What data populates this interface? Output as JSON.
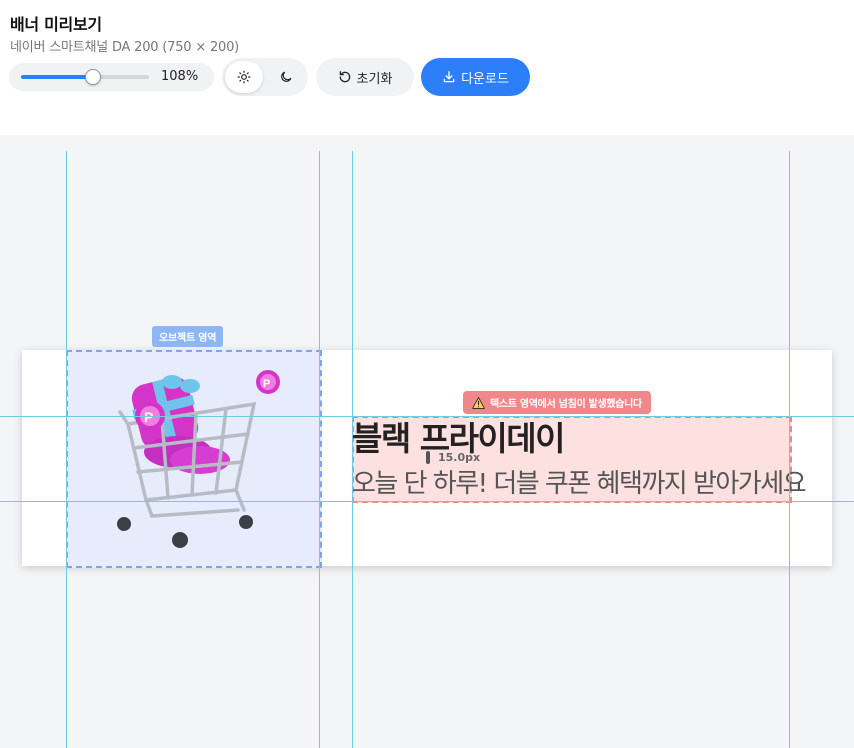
{
  "header": {
    "title": "배너 미리보기",
    "subtitle": "네이버 스마트채널 DA 200 (750 × 200)"
  },
  "toolbar": {
    "zoom": {
      "percent": 108,
      "label": "108%",
      "slider_fraction": 0.56
    },
    "theme": {
      "light_icon": "sun-icon",
      "dark_icon": "moon-icon",
      "active": "light"
    },
    "reset_label": "초기화",
    "reset_icon": "reset-icon",
    "download_label": "다운로드",
    "download_icon": "download-icon"
  },
  "banner": {
    "object_area_label": "오브젝트 영역",
    "warning_label": "텍스트 영역에서 넘침이 발생했습니다",
    "headline": "블랙 프라이데이",
    "subline": "오늘 단 하루! 더블 쿠폰 혜택까지 받아가세요",
    "gap_label": "15.0px",
    "product_image": "shopping-cart-with-gift-illustration"
  },
  "colors": {
    "accent": "#2d7ff9",
    "guide": "#6ecbe3",
    "object_area": "#7aa8f0",
    "overflow_warning": "#f0878a"
  }
}
